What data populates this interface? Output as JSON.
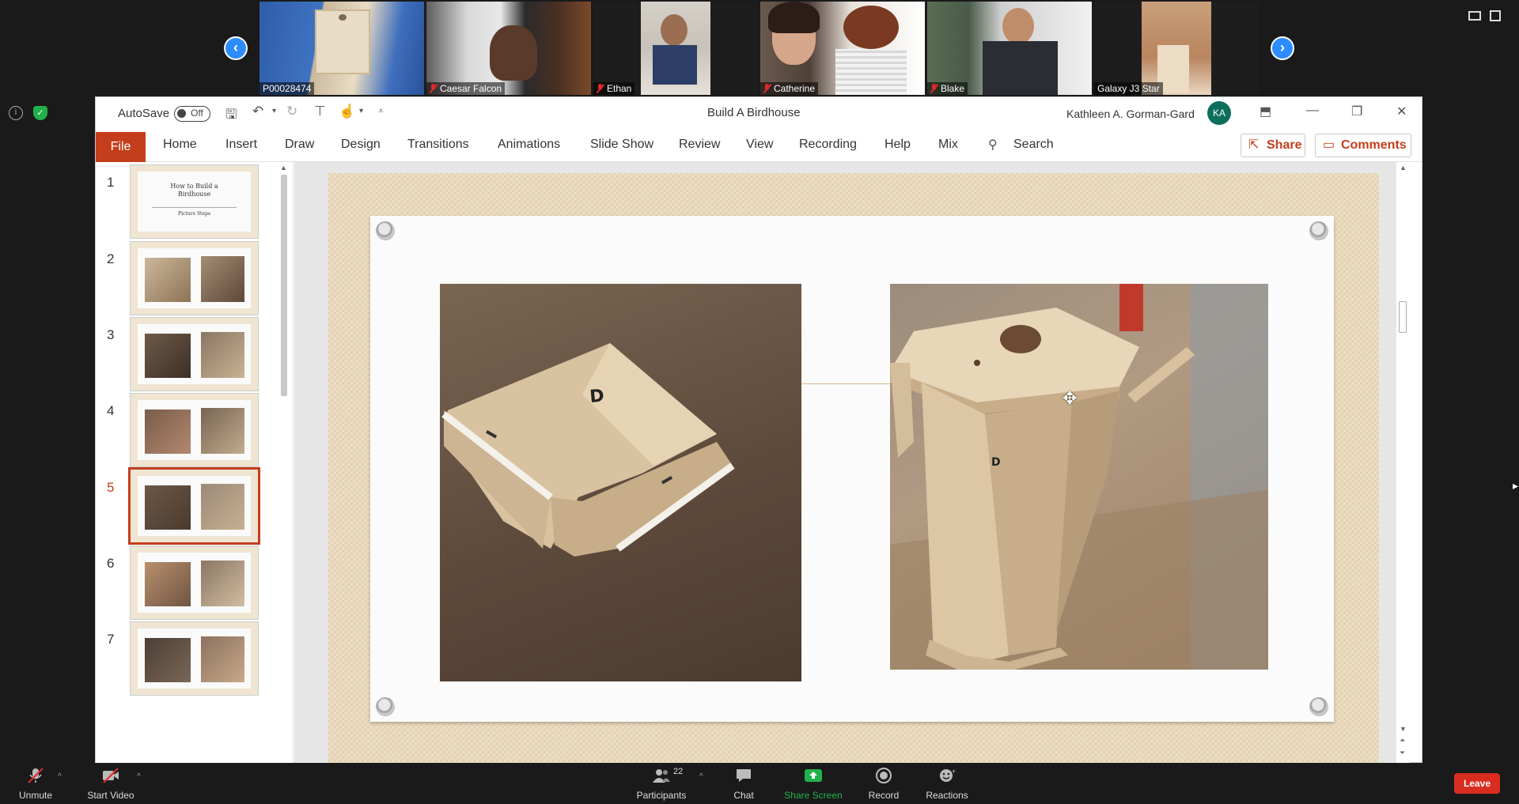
{
  "zoom": {
    "participants_tiles": [
      {
        "name": "P00028474",
        "muted": false
      },
      {
        "name": "Caesar Falcon",
        "muted": true
      },
      {
        "name": "Ethan",
        "muted": true
      },
      {
        "name": "Catherine",
        "muted": true
      },
      {
        "name": "Blake",
        "muted": true
      },
      {
        "name": "Galaxy J3 Star",
        "muted": false
      }
    ],
    "toolbar": {
      "unmute": "Unmute",
      "start_video": "Start Video",
      "participants": "Participants",
      "participants_count": "22",
      "chat": "Chat",
      "share_screen": "Share Screen",
      "record": "Record",
      "reactions": "Reactions",
      "leave": "Leave"
    },
    "colors": {
      "accent_blue": "#2d8cff",
      "share_green": "#21b14c",
      "leave_red": "#d92d20",
      "muted_red": "#e02828"
    }
  },
  "powerpoint": {
    "autosave_label": "AutoSave",
    "autosave_state": "Off",
    "document_title": "Build A Birdhouse",
    "user_name": "Kathleen A. Gorman-Gard",
    "user_initials": "KA",
    "ribbon_tabs": [
      "File",
      "Home",
      "Insert",
      "Draw",
      "Design",
      "Transitions",
      "Animations",
      "Slide Show",
      "Review",
      "View",
      "Recording",
      "Help",
      "Mix"
    ],
    "search_label": "Search",
    "share_label": "Share",
    "comments_label": "Comments",
    "accent_color": "#c43e1c",
    "slide_numbers": [
      "1",
      "2",
      "3",
      "4",
      "5",
      "6",
      "7"
    ],
    "selected_slide": "5",
    "thumb1": {
      "title": "How to Build a Birdhouse",
      "subtitle": "Picture Steps"
    }
  }
}
